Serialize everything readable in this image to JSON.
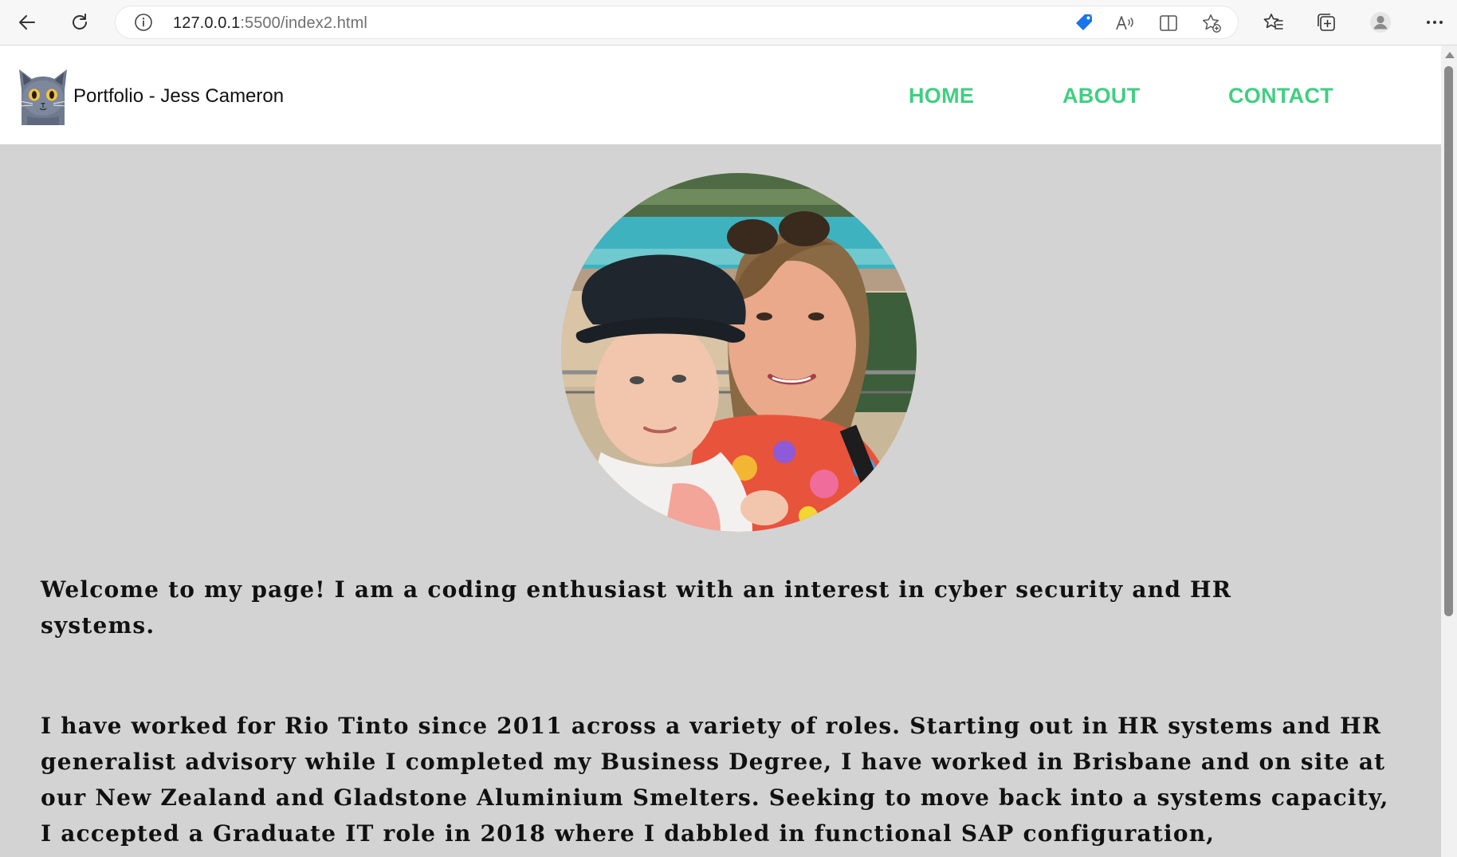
{
  "browser": {
    "url_host": "127.0.0.1",
    "url_path": ":5500/index2.html"
  },
  "navbar": {
    "brand": "Portfolio - Jess Cameron",
    "links": [
      {
        "label": "HOME"
      },
      {
        "label": "ABOUT"
      },
      {
        "label": "CONTACT"
      }
    ],
    "link_color": "#3fcf82"
  },
  "main": {
    "intro": "Welcome to my page! I am a coding enthusiast with an interest in cyber security and HR systems.",
    "bio": "I have worked for Rio Tinto since 2011 across a variety of roles. Starting out in HR systems and HR generalist advisory while I completed my Business Degree, I have worked in Brisbane and on site at our New Zealand and Gladstone Aluminium Smelters. Seeking to move back into a systems capacity, I accepted a Graduate IT role in 2018 where I dabbled in functional SAP configuration,"
  },
  "colors": {
    "page_background": "#d3d3d3",
    "navbar_background": "#ffffff"
  }
}
